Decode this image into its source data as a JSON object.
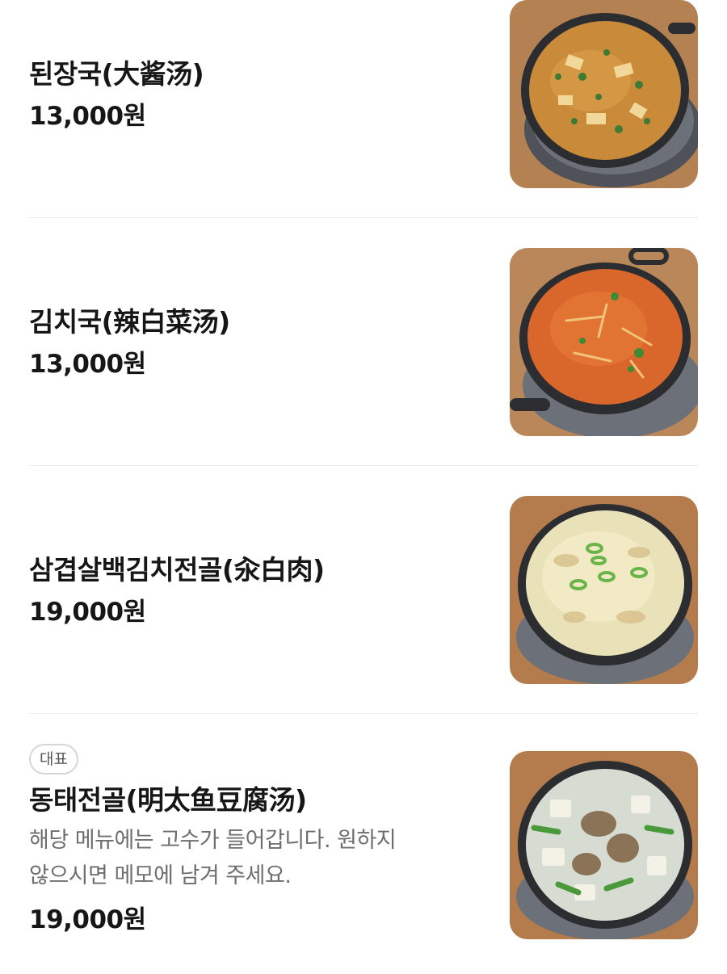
{
  "menu": {
    "items": [
      {
        "name": "된장국(大酱汤)",
        "price": "13,000원",
        "image": "doenjang-soup-photo"
      },
      {
        "name": "김치국(辣白菜汤)",
        "price": "13,000원",
        "image": "kimchi-soup-photo"
      },
      {
        "name": "삼겹살백김치전골(汆白肉)",
        "price": "19,000원",
        "image": "pork-white-kimchi-hotpot-photo"
      },
      {
        "badge": "대표",
        "name": "동태전골(明太鱼豆腐汤)",
        "description_line1": "해당 메뉴에는 고수가 들어갑니다. 원하지",
        "description_line2": "않으시면 메모에 남겨 주세요.",
        "price": "19,000원",
        "image": "pollock-hotpot-photo"
      }
    ]
  },
  "colors": {
    "wood": "#b07a45",
    "pot": "#2b2d31",
    "doenjang_broth": "#c98a3a",
    "kimchi_broth": "#d9662a",
    "white_broth": "#e9e2b8",
    "clear_broth": "#d7dcd2",
    "scallion": "#4a9a3c"
  }
}
